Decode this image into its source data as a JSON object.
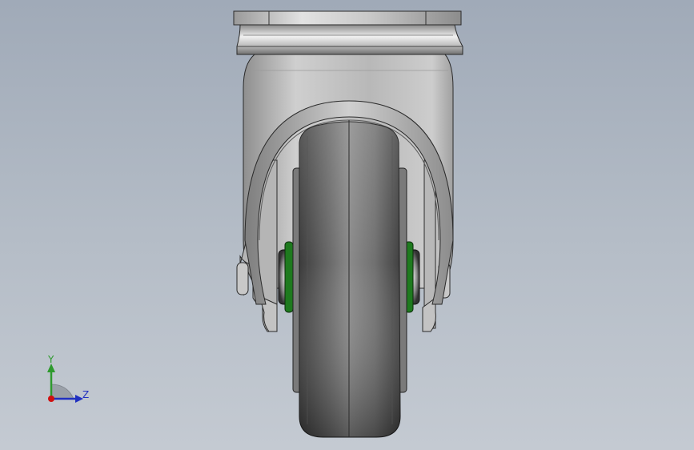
{
  "viewport": {
    "background_top": "#a0aab8",
    "background_bottom": "#c4cad2"
  },
  "model": {
    "name": "caster-wheel",
    "hub_accent_color": "#1e7a1e"
  },
  "triad": {
    "y_label": "Y",
    "z_label": "Z",
    "y_color": "#2e9a2e",
    "z_color": "#2030c0",
    "origin_color": "#d01010"
  }
}
